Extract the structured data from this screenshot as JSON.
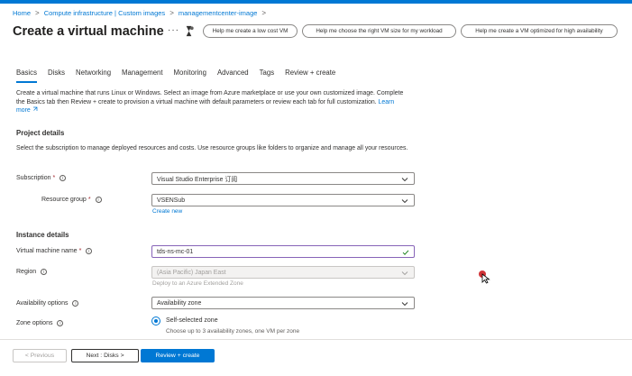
{
  "breadcrumb": {
    "items": [
      "Home",
      "Compute infrastructure | Custom images",
      "managementcenter-image"
    ],
    "separator": ">"
  },
  "page": {
    "title": "Create a virtual machine",
    "more": "···"
  },
  "copilot_prompts": [
    "Help me create a low cost VM",
    "Help me choose the right VM size for my workload",
    "Help me create a VM optimized for high availability"
  ],
  "tabs": [
    {
      "label": "Basics",
      "active": true
    },
    {
      "label": "Disks",
      "active": false
    },
    {
      "label": "Networking",
      "active": false
    },
    {
      "label": "Management",
      "active": false
    },
    {
      "label": "Monitoring",
      "active": false
    },
    {
      "label": "Advanced",
      "active": false
    },
    {
      "label": "Tags",
      "active": false
    },
    {
      "label": "Review + create",
      "active": false
    }
  ],
  "intro": {
    "text": "Create a virtual machine that runs Linux or Windows. Select an image from Azure marketplace or use your own customized image. Complete the Basics tab then Review + create to provision a virtual machine with default parameters or review each tab for full customization.",
    "learn_more": "Learn more"
  },
  "project_details": {
    "heading": "Project details",
    "description": "Select the subscription to manage deployed resources and costs. Use resource groups like folders to organize and manage all your resources.",
    "subscription": {
      "label": "Subscription",
      "required": "*",
      "value": "Visual Studio Enterprise 订阅"
    },
    "resource_group": {
      "label": "Resource group",
      "required": "*",
      "value": "VSENSub",
      "create_new": "Create new"
    }
  },
  "instance_details": {
    "heading": "Instance details",
    "vm_name": {
      "label": "Virtual machine name",
      "required": "*",
      "value": "tds-ns-mc-01"
    },
    "region": {
      "label": "Region",
      "value": "(Asia Pacific) Japan East",
      "note": "Deploy to an Azure Extended Zone"
    },
    "availability": {
      "label": "Availability options",
      "value": "Availability zone"
    },
    "zone": {
      "label": "Zone options",
      "selected": "Self-selected zone",
      "selected_desc": "Choose up to 3 availability zones, one VM per zone"
    }
  },
  "footer": {
    "previous": "< Previous",
    "next": "Next : Disks >",
    "review": "Review + create"
  },
  "colors": {
    "accent": "#0078d4",
    "valid_border": "#8764b8",
    "required": "#a4262c"
  }
}
